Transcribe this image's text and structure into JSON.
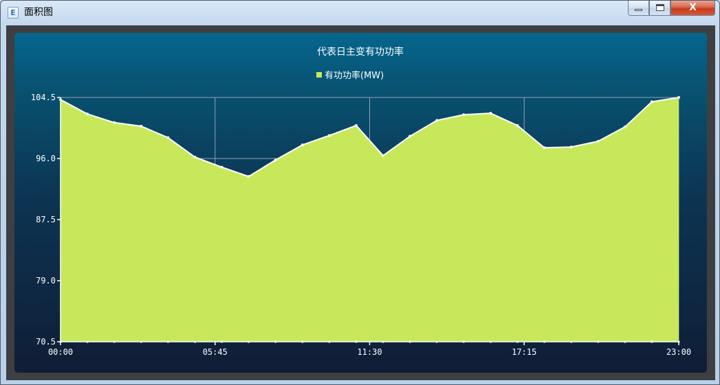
{
  "window": {
    "title": "面积图",
    "app_icon_letter": "E",
    "close_label": "X"
  },
  "colors": {
    "area_fill": "#c8e85c",
    "line": "#ffffff",
    "grid": "#8aa4b6"
  },
  "chart_data": {
    "type": "area",
    "title": "代表日主变有功功率",
    "legend": "有功功率(MW)",
    "legend_position": "top-center",
    "grid": true,
    "ylim": [
      70.5,
      104.5
    ],
    "yticks": [
      "104.5",
      "96.0",
      "87.5",
      "79.0",
      "70.5"
    ],
    "xticks": [
      "00:00",
      "05:45",
      "11:30",
      "17:15",
      "23:00"
    ],
    "xlim": [
      0,
      23
    ],
    "x": [
      0,
      1,
      2,
      3,
      4,
      5,
      6,
      7,
      8,
      9,
      10,
      11,
      12,
      13,
      14,
      15,
      16,
      17,
      18,
      19,
      20,
      21,
      22,
      23
    ],
    "series": [
      {
        "name": "有功功率(MW)",
        "values": [
          104.2,
          102.2,
          101.0,
          100.5,
          98.9,
          96.2,
          94.8,
          93.5,
          95.8,
          97.9,
          99.2,
          100.6,
          96.4,
          99.1,
          101.3,
          102.1,
          102.3,
          100.6,
          97.5,
          97.6,
          98.4,
          100.4,
          103.9,
          104.5
        ]
      }
    ]
  }
}
